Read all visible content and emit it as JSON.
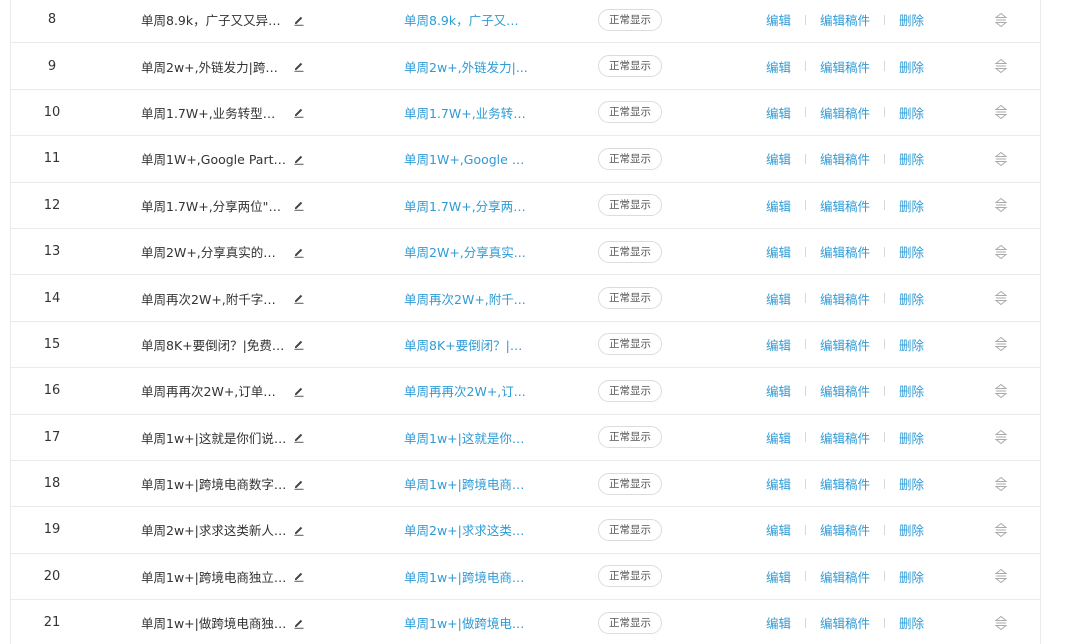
{
  "actions": {
    "edit": "编辑",
    "edit_draft": "编辑稿件",
    "delete": "删除"
  },
  "rows": [
    {
      "index": "8",
      "title": "单周8.9k，广子又又异常...",
      "link": "单周8.9k，广子又又...",
      "status": "正常显示"
    },
    {
      "index": "9",
      "title": "单周2w+,外链发力|跨境...",
      "link": "单周2w+,外链发力|...",
      "status": "正常显示"
    },
    {
      "index": "10",
      "title": "单周1.7W+,业务转型？|...",
      "link": "单周1.7W+,业务转型...",
      "status": "正常显示"
    },
    {
      "index": "11",
      "title": "单周1W+,Google Partne...",
      "link": "单周1W+,Google Pa...",
      "status": "正常显示"
    },
    {
      "index": "12",
      "title": "单周1.7W+,分享两位\"爆...",
      "link": "单周1.7W+,分享两位...",
      "status": "正常显示"
    },
    {
      "index": "13",
      "title": "单周2W+,分享真实的个...",
      "link": "单周2W+,分享真实...",
      "status": "正常显示"
    },
    {
      "index": "14",
      "title": "单周再次2W+,附千字谷...",
      "link": "单周再次2W+,附千...",
      "status": "正常显示"
    },
    {
      "index": "15",
      "title": "单周8K+要倒闭？|免费流...",
      "link": "单周8K+要倒闭？|免...",
      "status": "正常显示"
    },
    {
      "index": "16",
      "title": "单周再再次2W+,订单下...",
      "link": "单周再再次2W+,订...",
      "status": "正常显示"
    },
    {
      "index": "17",
      "title": "单周1w+|这就是你们说的...",
      "link": "单周1w+|这就是你们...",
      "status": "正常显示"
    },
    {
      "index": "18",
      "title": "单周1w+|跨境电商数字游...",
      "link": "单周1w+|跨境电商数...",
      "status": "正常显示"
    },
    {
      "index": "19",
      "title": "单周2w+|求求这类新人放...",
      "link": "单周2w+|求求这类新...",
      "status": "正常显示"
    },
    {
      "index": "20",
      "title": "单周1w+|跨境电商独立站...",
      "link": "单周1w+|跨境电商独...",
      "status": "正常显示"
    },
    {
      "index": "21",
      "title": "单周1w+|做跨境电商独立...",
      "link": "单周1w+|做跨境电商...",
      "status": "正常显示"
    }
  ],
  "icons": {
    "edit_title": "pencil-icon",
    "sort": "drag-sort-icon"
  },
  "colors": {
    "link": "#2f9bd6",
    "border": "#ebebeb",
    "text": "#333333"
  }
}
